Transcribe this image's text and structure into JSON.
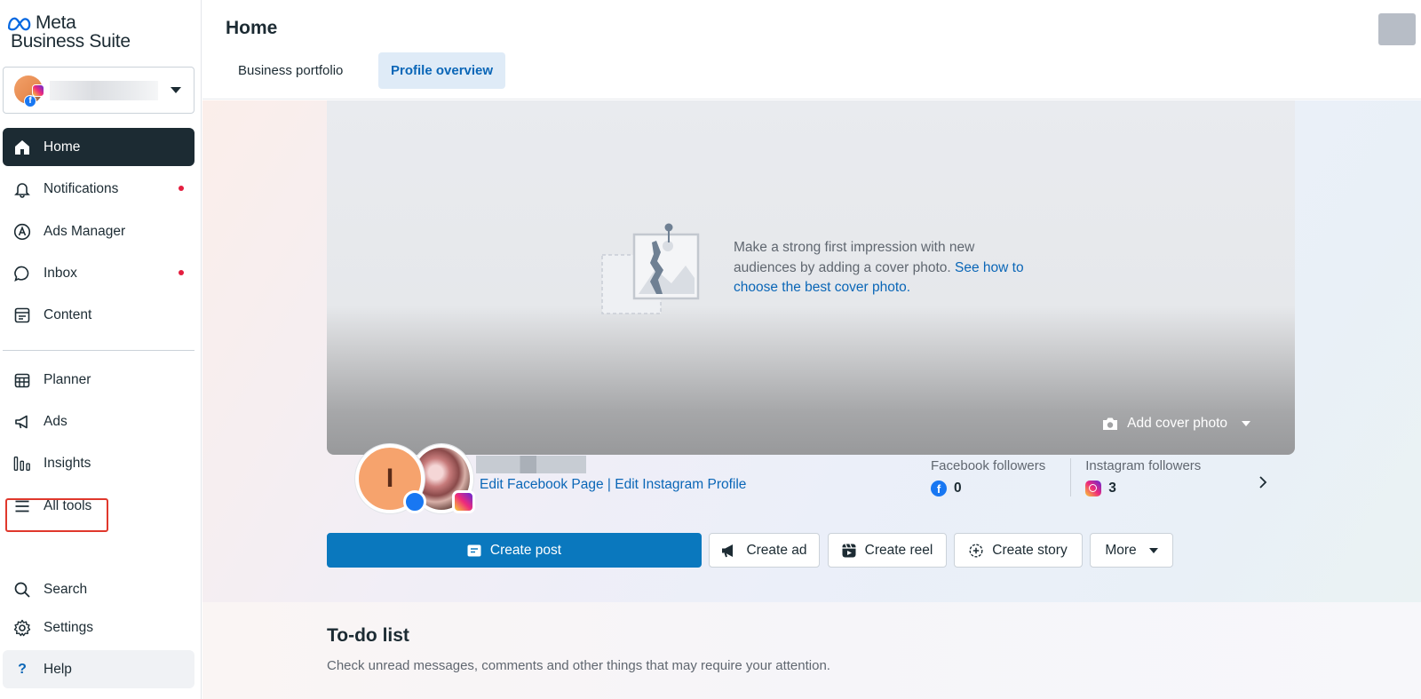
{
  "app": {
    "logo_line1": "Meta",
    "logo_line2": "Business Suite"
  },
  "sidebar": {
    "items": [
      {
        "label": "Home",
        "icon": "home-icon",
        "active": true
      },
      {
        "label": "Notifications",
        "icon": "bell-icon",
        "dot": true
      },
      {
        "label": "Ads Manager",
        "icon": "ads-manager-icon"
      },
      {
        "label": "Inbox",
        "icon": "chat-bubble-icon",
        "dot": true
      },
      {
        "label": "Content",
        "icon": "content-icon"
      },
      {
        "label": "Planner",
        "icon": "calendar-icon"
      },
      {
        "label": "Ads",
        "icon": "megaphone-icon"
      },
      {
        "label": "Insights",
        "icon": "bar-chart-icon"
      },
      {
        "label": "All tools",
        "icon": "menu-icon",
        "highlighted": true
      }
    ],
    "bottom_items": [
      {
        "label": "Search",
        "icon": "search-icon"
      },
      {
        "label": "Settings",
        "icon": "gear-icon"
      },
      {
        "label": "Help",
        "icon": "question-icon"
      }
    ]
  },
  "header": {
    "title": "Home",
    "tabs": [
      {
        "label": "Business portfolio",
        "active": false
      },
      {
        "label": "Profile overview",
        "active": true
      }
    ]
  },
  "profile": {
    "cover_prompt": "Make a strong first impression with new audiences by adding a cover photo.",
    "cover_link": "See how to choose the best cover photo.",
    "add_cover_label": "Add cover photo",
    "avatar_letter": "I",
    "edit_facebook_label": "Edit Facebook Page",
    "separator": "|",
    "edit_instagram_label": "Edit Instagram Profile",
    "stats": [
      {
        "label": "Facebook followers",
        "value": "0",
        "icon": "facebook-icon"
      },
      {
        "label": "Instagram followers",
        "value": "3",
        "icon": "instagram-icon"
      }
    ]
  },
  "actions": {
    "create_post": "Create post",
    "create_ad": "Create ad",
    "create_reel": "Create reel",
    "create_story": "Create story",
    "more": "More"
  },
  "todo": {
    "title": "To-do list",
    "subtitle": "Check unread messages, comments and other things that may require your attention."
  },
  "colors": {
    "primary": "#0a78be",
    "nav_active": "#1c2b33",
    "link": "#0a66b7",
    "notification_dot": "#e41e3f",
    "highlight_box": "#e0382c"
  }
}
